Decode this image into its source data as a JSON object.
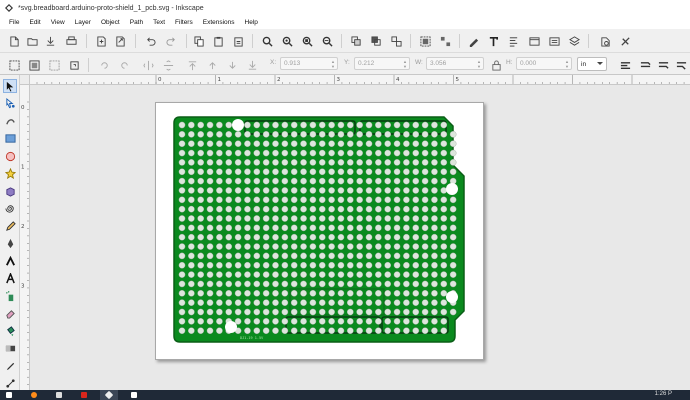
{
  "window": {
    "title": "*svg.breadboard.arduino-proto-shield_1_pcb.svg - Inkscape",
    "app_icon": "inkscape-logo-icon"
  },
  "menubar": {
    "items": [
      "File",
      "Edit",
      "View",
      "Layer",
      "Object",
      "Path",
      "Text",
      "Filters",
      "Extensions",
      "Help"
    ]
  },
  "commands_bar": {
    "buttons": [
      "new-document-icon",
      "open-icon",
      "import-icon",
      "print-icon",
      "import-file-icon",
      "export-icon",
      "undo-icon",
      "redo-icon",
      "copy-icon",
      "paste-icon",
      "paste-in-place-icon",
      "zoom-selection-icon",
      "zoom-drawing-icon",
      "zoom-page-icon",
      "zoom-width-icon",
      "duplicate-icon",
      "clone-icon",
      "unlink-clone-icon",
      "group-icon",
      "ungroup-icon",
      "fill-stroke-icon",
      "text-font-icon",
      "align-distribute-icon",
      "xml-editor-icon",
      "objects-icon",
      "layers-icon",
      "preferences-icon",
      "document-properties-icon"
    ]
  },
  "tool_controls": {
    "x_label": "X:",
    "x_value": "0.913",
    "y_label": "Y:",
    "y_value": "0.212",
    "w_label": "W:",
    "w_value": "3.056",
    "h_label": "H:",
    "h_value": "0.000",
    "unit": "in",
    "lock_icon": "lock-icon"
  },
  "toolbox": {
    "tools": [
      "selector-tool-icon",
      "node-tool-icon",
      "tweak-tool-icon",
      "rectangle-tool-icon",
      "circle-tool-icon",
      "star-tool-icon",
      "3d-box-tool-icon",
      "spiral-tool-icon",
      "pencil-tool-icon",
      "pen-tool-icon",
      "calligraphy-tool-icon",
      "text-tool-icon",
      "spray-tool-icon",
      "eraser-tool-icon",
      "paint-bucket-tool-icon",
      "gradient-tool-icon",
      "dropper-tool-icon",
      "connector-tool-icon"
    ],
    "active": "selector-tool-icon"
  },
  "rulers": {
    "h_labels": [
      "0",
      "1",
      "2",
      "3",
      "4",
      "5"
    ],
    "v_labels": [
      "0",
      "1",
      "2",
      "3"
    ]
  },
  "canvas": {
    "board_color": "#0a8a1e",
    "board_edge_color": "#0b5e17",
    "pad_color": "#dde6dd",
    "silk_text": "DJ1-19 1.5V"
  },
  "taskbar": {
    "apps": [
      "start-icon",
      "firefox-icon",
      "terminal-icon",
      "flash-icon",
      "inkscape-icon",
      "blank-window-icon"
    ],
    "active": "inkscape-icon",
    "clock": "1:26 P"
  }
}
